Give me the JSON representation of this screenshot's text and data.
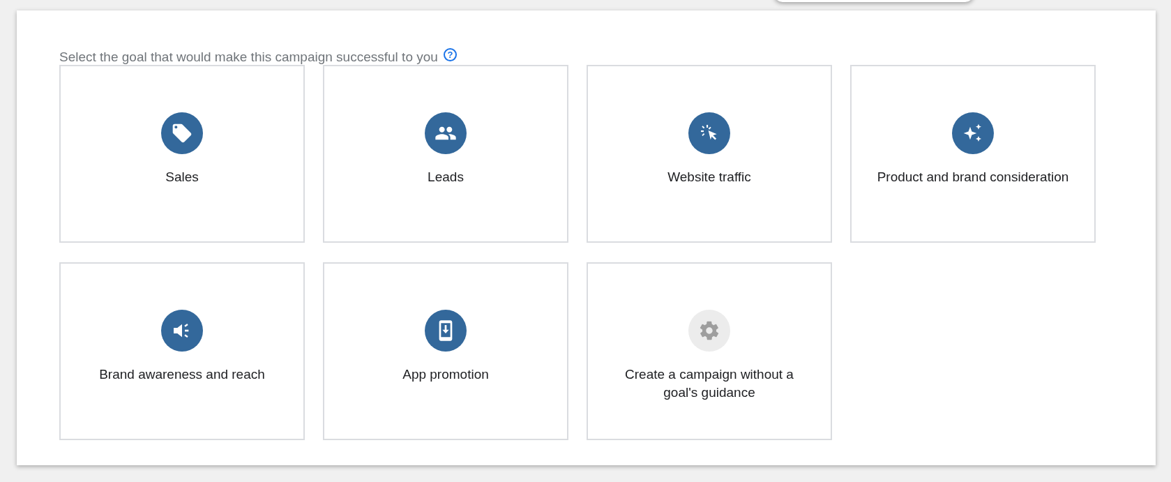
{
  "prompt": {
    "text": "Select the goal that would make this campaign successful to you",
    "help": "?"
  },
  "goals": [
    {
      "label": "Sales",
      "kind": "tag"
    },
    {
      "label": "Leads",
      "kind": "people"
    },
    {
      "label": "Website traffic",
      "kind": "cursor"
    },
    {
      "label": "Product and brand consideration",
      "kind": "sparkle"
    },
    {
      "label": "Brand awareness and reach",
      "kind": "speaker"
    },
    {
      "label": "App promotion",
      "kind": "phone"
    },
    {
      "label": "Create a campaign without a goal's guidance",
      "kind": "gear"
    }
  ]
}
